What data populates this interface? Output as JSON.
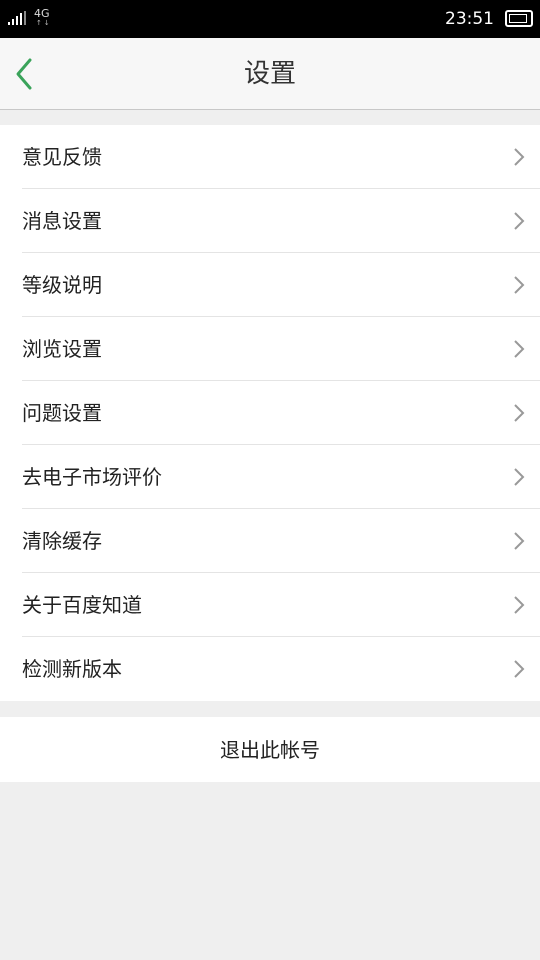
{
  "status_bar": {
    "network": "4G",
    "network_arrows": "↑↓",
    "time": "23:51",
    "signal_icon": "signal-bars-icon",
    "battery_icon": "battery-icon"
  },
  "nav": {
    "back_icon": "chevron-left-icon",
    "title": "设置"
  },
  "menu": {
    "items": [
      {
        "label": "意见反馈"
      },
      {
        "label": "消息设置"
      },
      {
        "label": "等级说明"
      },
      {
        "label": "浏览设置"
      },
      {
        "label": "问题设置"
      },
      {
        "label": "去电子市场评价"
      },
      {
        "label": "清除缓存"
      },
      {
        "label": "关于百度知道"
      },
      {
        "label": "检测新版本"
      }
    ],
    "chevron_icon": "chevron-right-icon"
  },
  "logout": {
    "label": "退出此帐号"
  },
  "colors": {
    "accent": "#3aa35a",
    "background": "#efefef",
    "status_bar": "#000000"
  }
}
